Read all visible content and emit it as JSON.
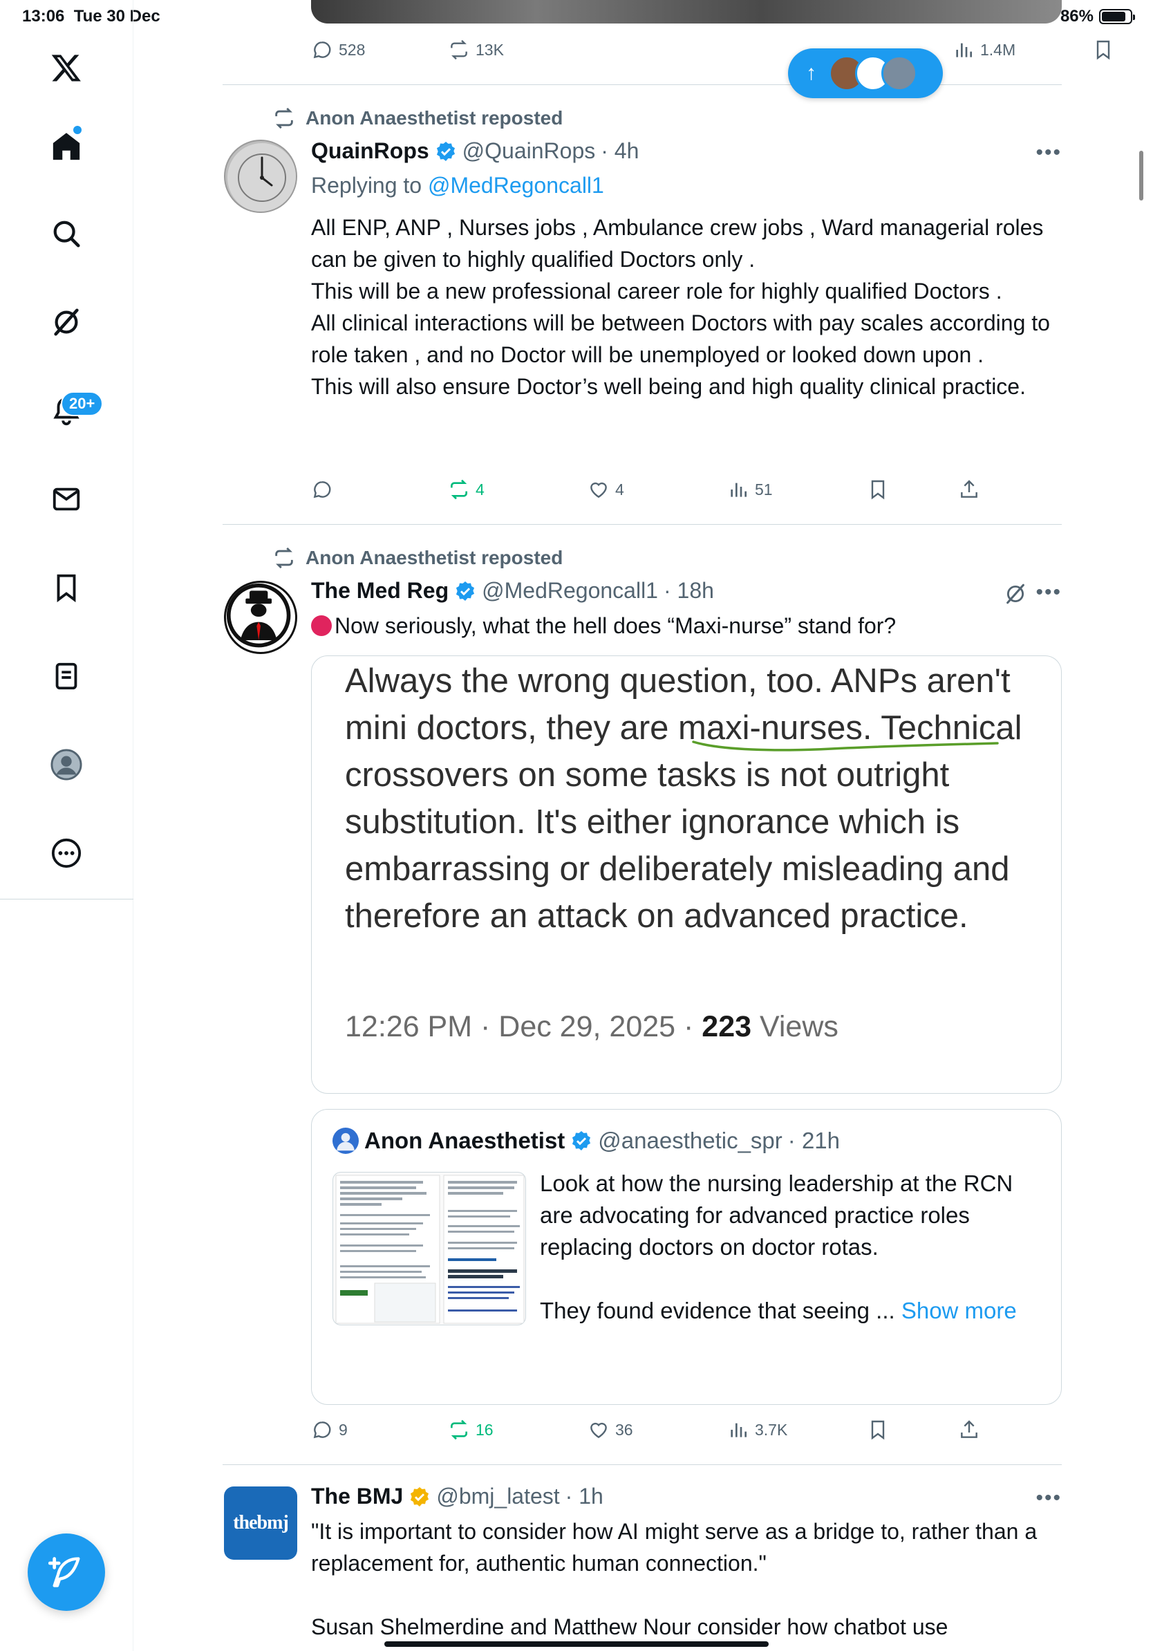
{
  "status_bar": {
    "time": "13:06",
    "date": "Tue 30 Dec",
    "battery": "86%"
  },
  "nav": {
    "notifications_badge": "20+",
    "items": [
      "home-icon",
      "search-icon",
      "grok-icon",
      "notifications-icon",
      "messages-icon",
      "bookmarks-icon",
      "lists-icon",
      "profile-icon",
      "more-icon"
    ]
  },
  "top_post": {
    "replies": "528",
    "reposts": "13K",
    "views": "1.4M"
  },
  "new_posts_pill": {
    "arrow": "↑"
  },
  "posts": [
    {
      "repost_by": "Anon Anaesthetist reposted",
      "name": "QuainRops",
      "handle": "@QuainRops",
      "time": "· 4h",
      "replying_prefix": "Replying to ",
      "replying_to": "@MedRegoncall1",
      "text": "All ENP, ANP , Nurses jobs , Ambulance crew jobs  , Ward managerial roles can be given to highly qualified Doctors only .\nThis will be a new professional career role for highly qualified Doctors .\nAll clinical interactions will be between Doctors with pay scales according to role taken , and no Doctor will be unemployed or looked down upon .\nThis will also ensure Doctor’s well being and high quality clinical practice.",
      "reposts": "4",
      "likes": "4",
      "views": "51"
    },
    {
      "repost_by": "Anon Anaesthetist reposted",
      "name": "The Med Reg",
      "handle": "@MedRegoncall1",
      "time": "· 18h",
      "text": "Now seriously, what the hell does “Maxi-nurse” stand for?",
      "image_text": "Always the wrong question, too. ANPs aren't mini doctors, they are maxi-nurses. Technical crossovers on some tasks is not outright substitution. It's either ignorance which is embarrassing or deliberately misleading and therefore an attack on advanced practice.",
      "image_meta_pre": "12:26 PM · Dec 29, 2025 · ",
      "image_meta_views": "223",
      "image_meta_post": " Views",
      "quote": {
        "name": "Anon Anaesthetist",
        "handle": "@anaesthetic_spr",
        "time": "· 21h",
        "text": "Look at how the nursing leadership at the RCN are advocating for advanced practice roles replacing doctors on doctor rotas.\n\nThey found evidence that seeing ... ",
        "show_more": "Show more"
      },
      "replies": "9",
      "reposts": "16",
      "likes": "36",
      "views": "3.7K"
    },
    {
      "name": "The BMJ",
      "handle": "@bmj_latest",
      "time": "· 1h",
      "avatar_text": "thebmj",
      "text": "\"It is important to consider how AI might serve as a bridge to, rather than a replacement for, authentic human connection.\"\n\nSusan Shelmerdine and Matthew Nour consider how chatbot use"
    }
  ],
  "colors": {
    "accent": "#1d9bf0",
    "repost_green": "#00ba7c",
    "secondary_text": "#536471",
    "gold_verified": "#f4b400",
    "live_dot": "#e0245e"
  }
}
